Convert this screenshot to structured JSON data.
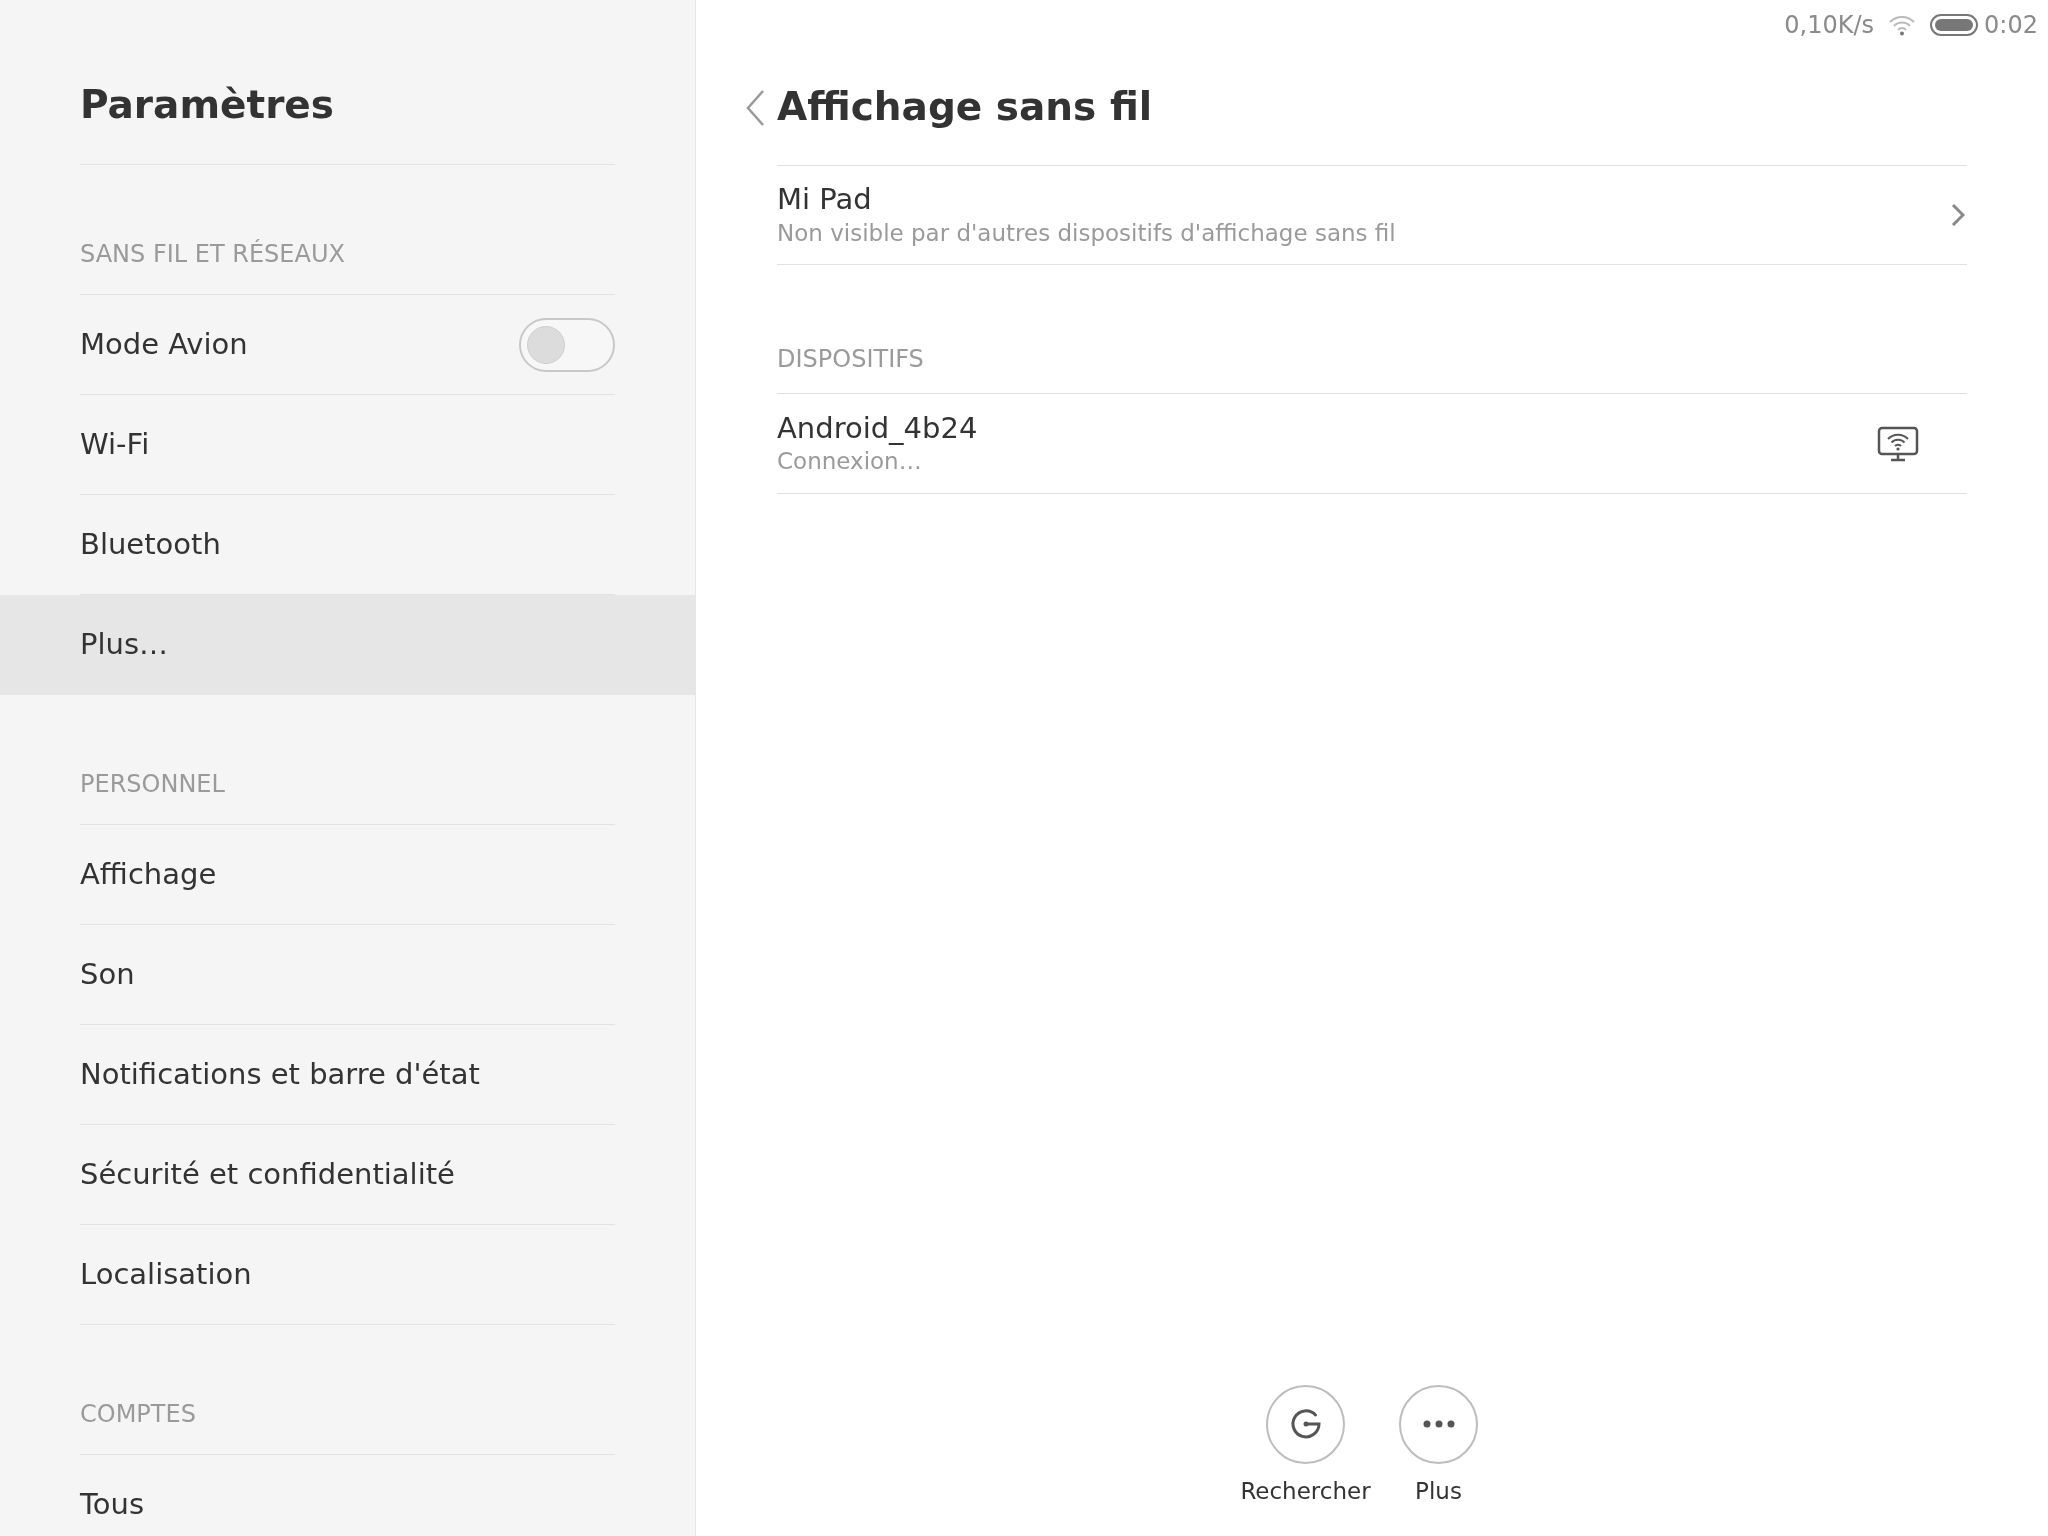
{
  "sidebar": {
    "title": "Paramètres",
    "sections": [
      {
        "header": "SANS FIL ET RÉSEAUX",
        "items": [
          {
            "label": "Mode Avion",
            "kind": "toggle",
            "on": false,
            "selected": false
          },
          {
            "label": "Wi-Fi",
            "kind": "link",
            "selected": false
          },
          {
            "label": "Bluetooth",
            "kind": "link",
            "selected": false
          },
          {
            "label": "Plus…",
            "kind": "link",
            "selected": true
          }
        ]
      },
      {
        "header": "PERSONNEL",
        "items": [
          {
            "label": "Affichage",
            "kind": "link",
            "selected": false
          },
          {
            "label": "Son",
            "kind": "link",
            "selected": false
          },
          {
            "label": "Notifications et barre d'état",
            "kind": "link",
            "selected": false
          },
          {
            "label": "Sécurité et confidentialité",
            "kind": "link",
            "selected": false
          },
          {
            "label": "Localisation",
            "kind": "link",
            "selected": false
          }
        ]
      },
      {
        "header": "COMPTES",
        "items": [
          {
            "label": "Tous",
            "kind": "link",
            "selected": false
          }
        ]
      }
    ]
  },
  "status_bar": {
    "network_speed": "0,10K/s",
    "time": "0:02"
  },
  "page": {
    "title": "Affichage sans fil",
    "device_name": {
      "title": "Mi Pad",
      "subtitle": "Non visible par d'autres dispositifs d'affichage sans fil"
    },
    "devices_header": "DISPOSITIFS",
    "devices": [
      {
        "name": "Android_4b24",
        "status": "Connexion…"
      }
    ],
    "actions": [
      {
        "kind": "search",
        "label": "Rechercher"
      },
      {
        "kind": "more",
        "label": "Plus"
      }
    ]
  }
}
